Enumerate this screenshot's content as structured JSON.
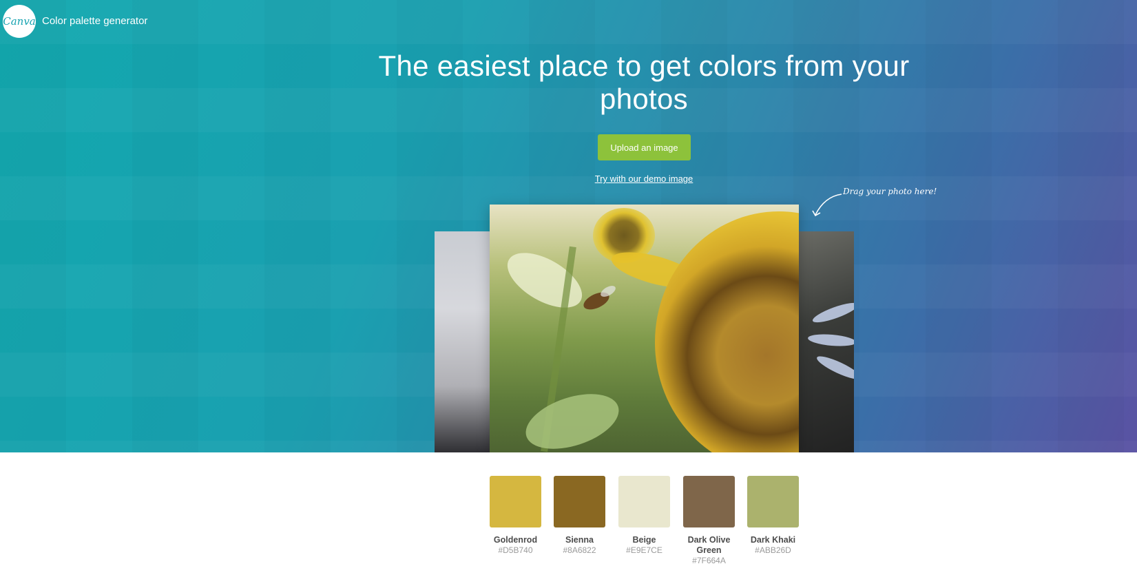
{
  "header": {
    "logo_text": "Canva",
    "app_name": "Color palette generator"
  },
  "hero": {
    "headline": "The easiest place to get colors from your photos",
    "upload_button": "Upload an image",
    "demo_link": "Try with our demo image",
    "drag_hint": "Drag your photo here!"
  },
  "palette": [
    {
      "name": "Goldenrod",
      "hex": "#D5B740",
      "color": "#D5B740"
    },
    {
      "name": "Sienna",
      "hex": "#8A6822",
      "color": "#8A6822"
    },
    {
      "name": "Beige",
      "hex": "#E9E7CE",
      "color": "#E9E7CE"
    },
    {
      "name": "Dark Olive Green",
      "hex": "#7F664A",
      "color": "#7F664A"
    },
    {
      "name": "Dark Khaki",
      "hex": "#ABB26D",
      "color": "#ABB26D"
    }
  ],
  "colors": {
    "button": "#8DC23B",
    "brand": "#17A3B1"
  }
}
